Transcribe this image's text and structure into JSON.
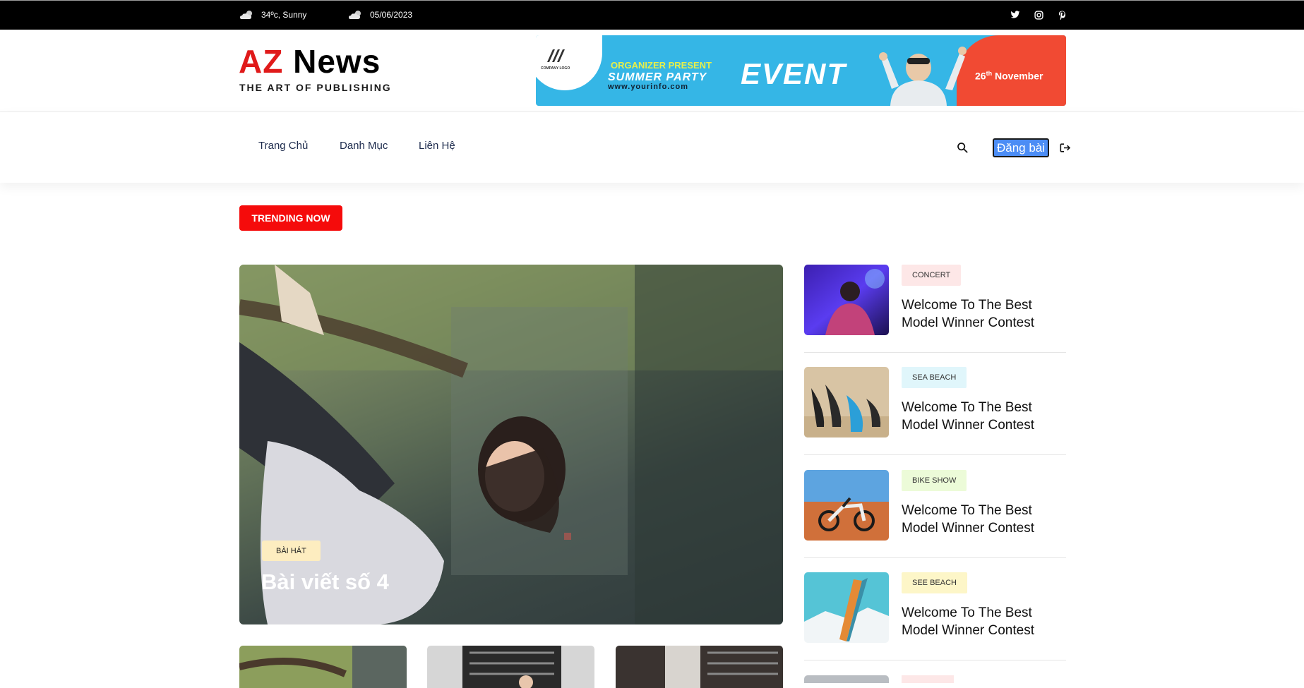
{
  "topbar": {
    "weather": "34ºc, Sunny",
    "date": "05/06/2023",
    "weather_icon": "cloud-sun-icon",
    "date_icon": "cloud-icon",
    "social_icons": [
      "twitter-icon",
      "instagram-icon",
      "pinterest-icon"
    ]
  },
  "header": {
    "logo_az": "AZ",
    "logo_news": "News",
    "tagline": "THE ART OF PUBLISHING"
  },
  "banner": {
    "organizer": "ORGANIZER PRESENT",
    "party": "SUMMER PARTY",
    "url": "www.yourinfo.com",
    "event": "EVENT",
    "date_day": "26",
    "date_sup": "th",
    "date_month": " November",
    "company_logo": "COMPANY LOGO"
  },
  "nav": {
    "items": [
      "Trang Chủ",
      "Danh Mục",
      "Liên Hệ"
    ],
    "post_button": "Đăng bài",
    "search_icon": "search-icon",
    "logout_icon": "logout-icon"
  },
  "trending": {
    "label": "TRENDING NOW"
  },
  "hero": {
    "tag": "BÀI HÁT",
    "title": "Bài viết số 4"
  },
  "side": [
    {
      "tag": "CONCERT",
      "title": "Welcome To The Best Model Winner Contest"
    },
    {
      "tag": "SEA BEACH",
      "title": "Welcome To The Best Model Winner Contest"
    },
    {
      "tag": "BIKE SHOW",
      "title": "Welcome To The Best Model Winner Contest"
    },
    {
      "tag": "SEE BEACH",
      "title": "Welcome To The Best Model Winner Contest"
    }
  ],
  "colors": {
    "accent_red": "#f50b0b",
    "nav_text": "#1d2b4d",
    "post_button": "#4c8df5"
  }
}
